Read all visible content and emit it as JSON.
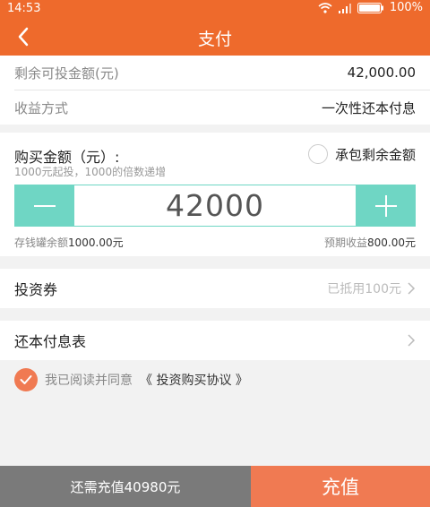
{
  "status_bar": {
    "time": "14:53",
    "battery": "100%"
  },
  "nav": {
    "title": "支付"
  },
  "summary": {
    "remaining_label": "剩余可投金额(元)",
    "remaining_value": "42,000.00",
    "income_label": "收益方式",
    "income_value": "一次性还本付息"
  },
  "purchase": {
    "title": "购买金额（元）:",
    "hint": "1000元起投，1000的倍数递增",
    "contract_label": "承包剩余金额",
    "amount": "42000",
    "piggy_label": "存钱罐余额",
    "piggy_value": "1000.00元",
    "expected_label": "预期收益",
    "expected_value": "800.00元"
  },
  "coupon": {
    "label": "投资券",
    "value": "已抵用100元"
  },
  "repayment": {
    "label": "还本付息表"
  },
  "agreement": {
    "prefix": "我已阅读并同意",
    "link": "《 投资购买协议 》"
  },
  "bottom": {
    "need_recharge": "还需充值40980元",
    "recharge_button": "充值"
  },
  "colors": {
    "brand_orange": "#ee6a2c",
    "teal": "#6fd6c4",
    "button_coral": "#f07a52"
  },
  "icons": [
    "wifi-icon",
    "signal-icon",
    "battery-icon",
    "back-arrow-icon",
    "minus-icon",
    "plus-icon",
    "chevron-right-icon",
    "checkmark-icon"
  ]
}
